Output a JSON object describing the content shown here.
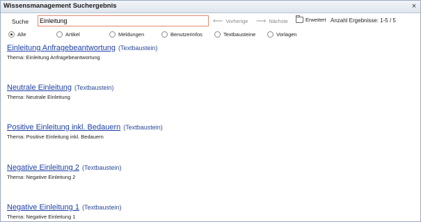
{
  "window": {
    "title": "Wissensmanagement Suchergebnis",
    "close_glyph": "×"
  },
  "search": {
    "label": "Suche",
    "value": "Einleitung"
  },
  "toolbar": {
    "prev_label": "Vorherige",
    "next_label": "Nächste",
    "extended_label": "Erweitert",
    "count_text": "Anzahl Ergebnisse: 1-5 / 5"
  },
  "filters": [
    {
      "label": "Alle",
      "selected": true
    },
    {
      "label": "Artikel",
      "selected": false
    },
    {
      "label": "Meldungen",
      "selected": false
    },
    {
      "label": "Benutzerinfos",
      "selected": false
    },
    {
      "label": "Textbausteine",
      "selected": false
    },
    {
      "label": "Vorlagen",
      "selected": false
    }
  ],
  "results": [
    {
      "title": "Einleitung Anfragebeantwortung",
      "kind": "(Textbaustein)",
      "thema": "Thema: Einleitung Anfragebeantwortung"
    },
    {
      "title": "Neutrale Einleitung",
      "kind": "(Textbaustein)",
      "thema": "Thema: Neutrale Einleitung"
    },
    {
      "title": "Positive Einleitung inkl. Bedauern",
      "kind": "(Textbaustein)",
      "thema": "Thema: Positive Einleitung inkl. Bedauern"
    },
    {
      "title": "Negative Einleitung 2",
      "kind": "(Textbaustein)",
      "thema": "Thema: Negative Einleitung 2"
    },
    {
      "title": "Negative Einleitung 1",
      "kind": "(Textbaustein)",
      "thema": "Thema: Negative Einleitung 1"
    }
  ],
  "icons": {
    "prev": "arrow-left-icon",
    "next": "arrow-right-icon",
    "extended": "folder-icon",
    "close": "close-icon"
  }
}
